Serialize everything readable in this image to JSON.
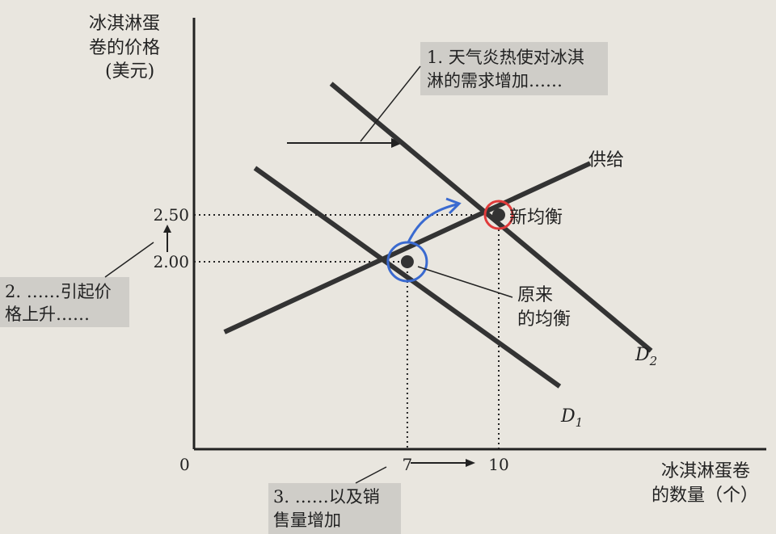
{
  "chart_data": {
    "type": "line",
    "y_axis_label": [
      "冰淇淋蛋",
      "卷的价格",
      "(美元)"
    ],
    "x_axis_label": [
      "冰淇淋蛋卷",
      "的数量（个）"
    ],
    "origin_label": "0",
    "x_ticks": [
      {
        "value": 7,
        "label": "7"
      },
      {
        "value": 10,
        "label": "10"
      }
    ],
    "y_ticks": [
      {
        "value": 2.0,
        "label": "2.00"
      },
      {
        "value": 2.5,
        "label": "2.50"
      }
    ],
    "series": [
      {
        "name": "供给",
        "points": [
          [
            1,
            1.25
          ],
          [
            13,
            3.05
          ]
        ]
      },
      {
        "name": "D1",
        "points": [
          [
            2,
            3.0
          ],
          [
            12,
            0.67
          ]
        ]
      },
      {
        "name": "D2",
        "points": [
          [
            4.5,
            3.9
          ],
          [
            15,
            1.05
          ]
        ]
      }
    ],
    "equilibria": [
      {
        "label": [
          "原来",
          "的均衡"
        ],
        "x": 7,
        "y": 2.0,
        "marker_color": "#3a6ad0"
      },
      {
        "label": [
          "新均衡"
        ],
        "x": 10,
        "y": 2.5,
        "marker_color": "#e03a3a"
      }
    ],
    "annotations": {
      "demand_increase": [
        "1. 天气炎热使对冰淇",
        "淋的需求增加……"
      ],
      "price_rise": [
        "2. ……引起价",
        "格上升……"
      ],
      "quantity_rise": [
        "3. ……以及销",
        "售量增加"
      ]
    },
    "d1_label": {
      "main": "D",
      "sub": "1"
    },
    "d2_label": {
      "main": "D",
      "sub": "2"
    }
  }
}
